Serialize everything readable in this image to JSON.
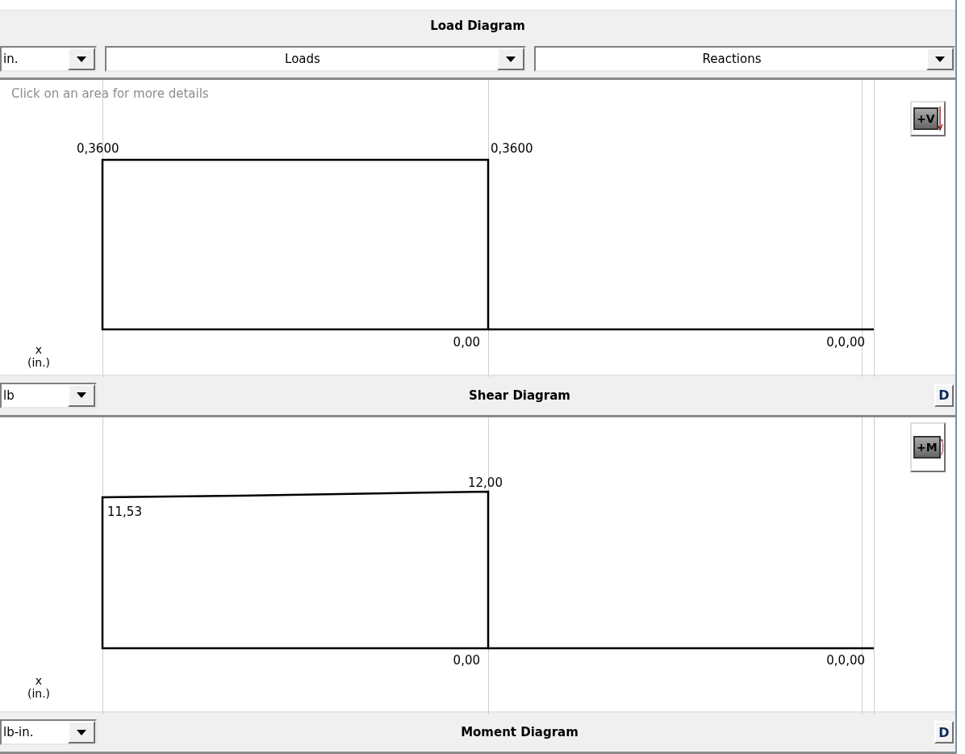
{
  "load_diagram": {
    "title": "Load Diagram",
    "selects": [
      {
        "value": "in."
      },
      {
        "value": "Loads"
      },
      {
        "value": "Reactions"
      }
    ],
    "canvas": {
      "kind": "load",
      "hint": "Click on an area for more details",
      "sign_button": "+V",
      "axis_label": [
        "x",
        "(in.)"
      ],
      "labels": [
        "0,3600",
        "0,3600",
        "0,00",
        "0,0,00"
      ]
    }
  },
  "shear_diagram": {
    "unit": "lb",
    "title": "Shear Diagram",
    "d_button": "D",
    "canvas": {
      "kind": "shear",
      "sign_button": "+M",
      "axis_label": [
        "x",
        "(in.)"
      ],
      "labels": [
        "12,00",
        "11,53",
        "0,00",
        "0,0,00"
      ]
    }
  },
  "moment_diagram": {
    "unit": "lb-in.",
    "title": "Moment Diagram",
    "d_button": "D"
  }
}
